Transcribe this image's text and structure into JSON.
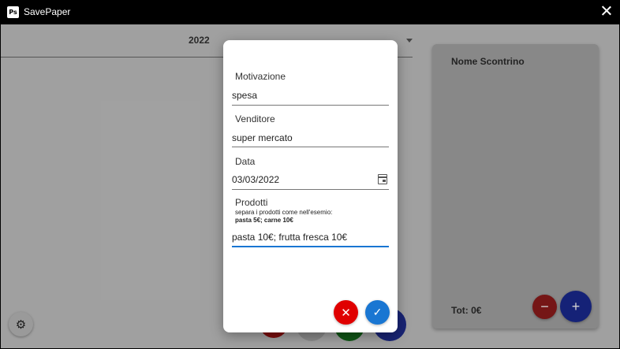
{
  "window": {
    "icon_text": "Ps",
    "title": "SavePaper"
  },
  "main": {
    "year": "2022"
  },
  "card": {
    "title": "Nome Scontrino",
    "total": "Tot: 0€",
    "minus_icon": "minus-icon",
    "plus_icon": "plus-icon"
  },
  "dialog": {
    "motivazione": {
      "label": "Motivazione",
      "value": "spesa"
    },
    "venditore": {
      "label": "Venditore",
      "value": "super mercato"
    },
    "data": {
      "label": "Data",
      "value": "03/03/2022"
    },
    "prodotti": {
      "label": "Prodotti",
      "hint": "separa i prodotti come nell'esemio:",
      "example": "pasta 5€; carne 10€",
      "value": "pasta 10€; frutta fresca 10€"
    }
  },
  "colors": {
    "accent": "#1976d2",
    "cancel": "#e00000",
    "card_plus": "#1a2a92",
    "card_minus": "#8f1b1b"
  }
}
